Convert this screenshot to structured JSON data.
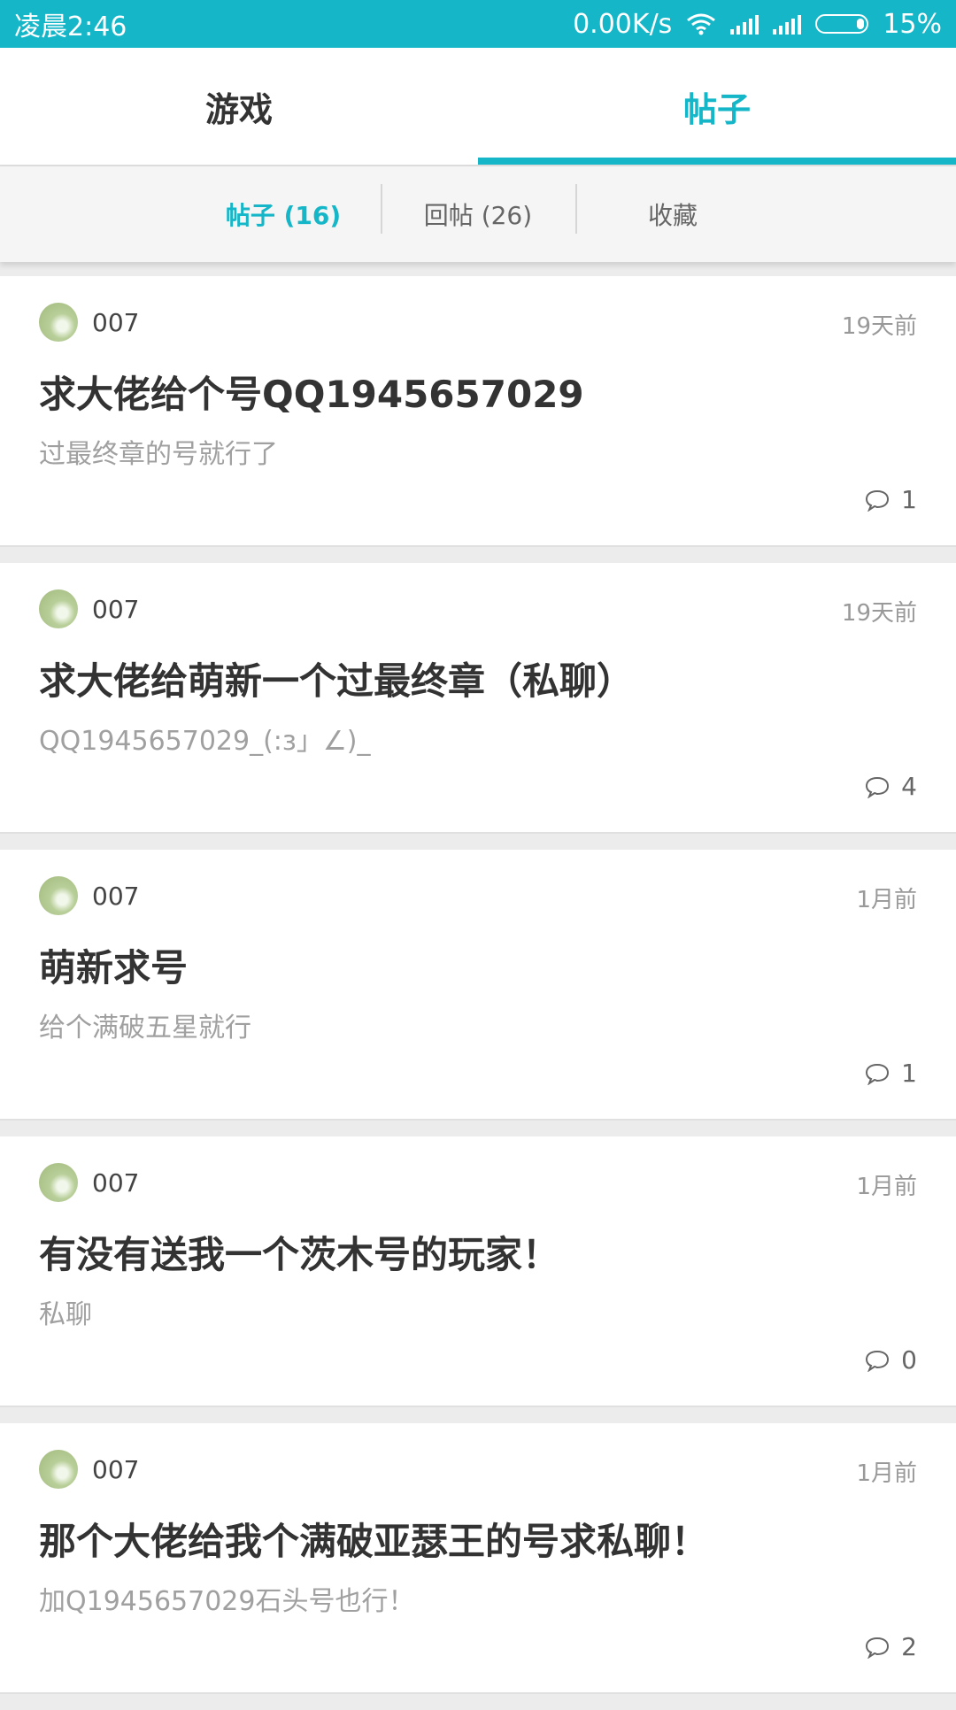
{
  "status_bar": {
    "time": "凌晨2:46",
    "net_speed": "0.00K/s",
    "battery": "15%"
  },
  "tabs": [
    {
      "label": "游戏",
      "active": false
    },
    {
      "label": "帖子",
      "active": true
    }
  ],
  "subtabs": [
    {
      "label": "帖子 (16)",
      "active": true
    },
    {
      "label": "回帖 (26)",
      "active": false
    },
    {
      "label": "收藏",
      "active": false
    }
  ],
  "posts": [
    {
      "author": "007",
      "time": "19天前",
      "title": "求大佬给个号QQ1945657029",
      "excerpt": "过最终章的号就行了",
      "comments": "1"
    },
    {
      "author": "007",
      "time": "19天前",
      "title": "求大佬给萌新一个过最终章（私聊）",
      "excerpt": "QQ1945657029_(:з」∠)_",
      "comments": "4"
    },
    {
      "author": "007",
      "time": "1月前",
      "title": "萌新求号",
      "excerpt": "给个满破五星就行",
      "comments": "1"
    },
    {
      "author": "007",
      "time": "1月前",
      "title": "有没有送我一个茨木号的玩家！",
      "excerpt": "私聊",
      "comments": "0"
    },
    {
      "author": "007",
      "time": "1月前",
      "title": "那个大佬给我个满破亚瑟王的号求私聊！",
      "excerpt": "加Q1945657029石头号也行！",
      "comments": "2"
    }
  ],
  "colors": {
    "accent": "#14b6c8"
  }
}
